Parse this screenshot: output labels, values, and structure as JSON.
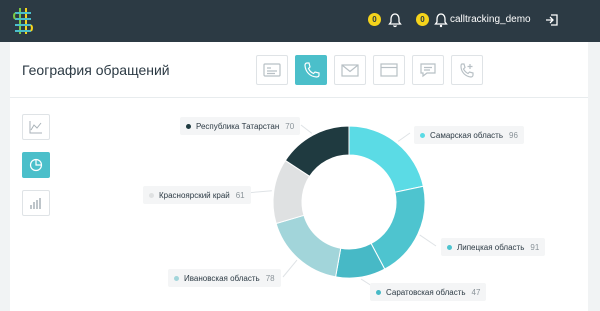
{
  "header": {
    "username": "calltracking_demo",
    "notifications": [
      {
        "count": "0",
        "icon": "bell-outline-icon"
      },
      {
        "count": "0",
        "icon": "bell-icon"
      }
    ],
    "logout_icon": "logout-icon",
    "logo_icon": "calltracking-logo-icon",
    "background": "#2c3a44",
    "badge_color": "#f5d31b"
  },
  "page": {
    "title": "География обращений"
  },
  "tabs": [
    {
      "icon": "form-icon",
      "active": false
    },
    {
      "icon": "phone-icon",
      "active": true
    },
    {
      "icon": "mail-icon",
      "active": false
    },
    {
      "icon": "browser-window-icon",
      "active": false
    },
    {
      "icon": "chat-icon",
      "active": false
    },
    {
      "icon": "phone-callback-icon",
      "active": false
    }
  ],
  "view_switcher": [
    {
      "icon": "line-chart-icon",
      "active": false
    },
    {
      "icon": "pie-chart-icon",
      "active": true
    },
    {
      "icon": "bar-chart-icon",
      "active": false
    }
  ],
  "accent_color": "#4bbfca",
  "chart_data": {
    "type": "pie",
    "donut": true,
    "slices": [
      {
        "label": "Самарская область",
        "value": 96,
        "color": "#5bdbe5"
      },
      {
        "label": "Липецкая область",
        "value": 91,
        "color": "#4ec4cf"
      },
      {
        "label": "Саратовская область",
        "value": 47,
        "color": "#47b9c6"
      },
      {
        "label": "Ивановская область",
        "value": 78,
        "color": "#a2d5da"
      },
      {
        "label": "Красноярский край",
        "value": 61,
        "color": "#dfe1e2"
      },
      {
        "label": "Республика Татарстан",
        "value": 70,
        "color": "#1f3a40"
      }
    ]
  }
}
